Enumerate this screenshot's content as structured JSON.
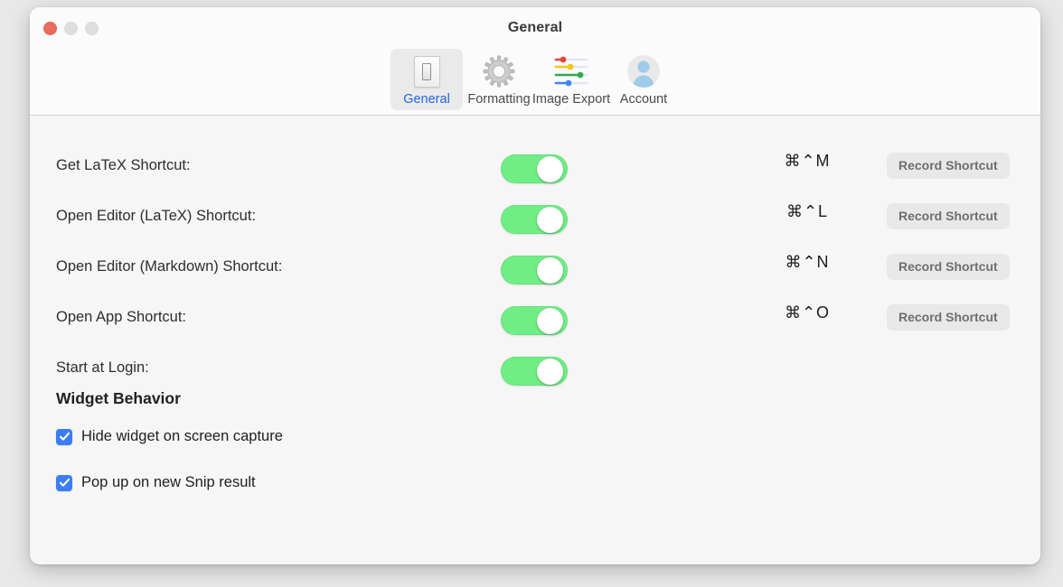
{
  "window": {
    "title": "General",
    "traffic_lights": [
      {
        "name": "close",
        "color": "#ea6a5e"
      },
      {
        "name": "minimize",
        "color": "#dedede"
      },
      {
        "name": "maximize",
        "color": "#dedede"
      }
    ]
  },
  "toolbar": {
    "tabs": [
      {
        "label": "General",
        "icon": "light-switch-icon",
        "selected": true
      },
      {
        "label": "Formatting",
        "icon": "gear-icon",
        "selected": false
      },
      {
        "label": "Image Export",
        "icon": "sliders-icon",
        "selected": false
      },
      {
        "label": "Account",
        "icon": "person-avatar-icon",
        "selected": false
      }
    ],
    "selected_tab_color": "#2266e8"
  },
  "settings": {
    "rows": [
      {
        "label": "Get LaTeX Shortcut:",
        "toggle_on": true,
        "shortcut": "⌘⌃M",
        "record_label": "Record Shortcut",
        "has_shortcut": true
      },
      {
        "label": "Open Editor (LaTeX) Shortcut:",
        "toggle_on": true,
        "shortcut": "⌘⌃L",
        "record_label": "Record Shortcut",
        "has_shortcut": true
      },
      {
        "label": "Open Editor (Markdown) Shortcut:",
        "toggle_on": true,
        "shortcut": "⌘⌃N",
        "record_label": "Record Shortcut",
        "has_shortcut": true
      },
      {
        "label": "Open App Shortcut:",
        "toggle_on": true,
        "shortcut": "⌘⌃O",
        "record_label": "Record Shortcut",
        "has_shortcut": true
      },
      {
        "label": "Start at Login:",
        "toggle_on": true,
        "shortcut": "",
        "record_label": "",
        "has_shortcut": false
      }
    ],
    "toggle_on_color": "#6fee85"
  },
  "widget_behavior": {
    "title": "Widget Behavior",
    "checkbox_color": "#3b7df6",
    "options": [
      {
        "label": "Hide widget on screen capture",
        "checked": true
      },
      {
        "label": "Pop up on new Snip result",
        "checked": true
      }
    ]
  }
}
